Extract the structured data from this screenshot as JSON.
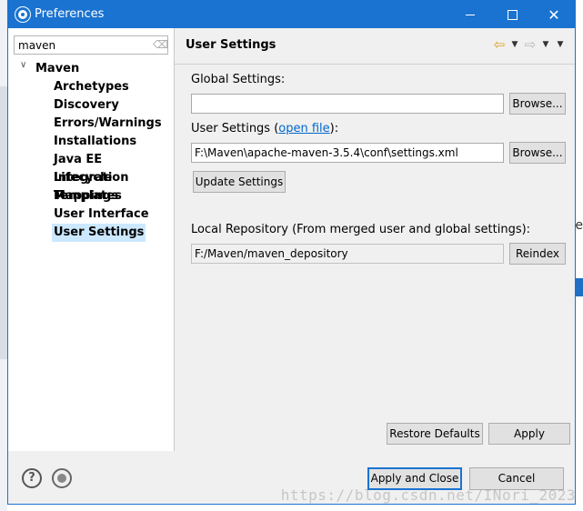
{
  "window": {
    "title": "Preferences"
  },
  "filter": {
    "value": "maven"
  },
  "tree": {
    "root": "Maven",
    "items": [
      "Archetypes",
      "Discovery",
      "Errors/Warnings",
      "Installations",
      "Java EE Integration",
      "Lifecycle Mappings",
      "Templates",
      "User Interface",
      "User Settings"
    ],
    "selected": "User Settings"
  },
  "page": {
    "title": "User Settings",
    "global_label": "Global Settings:",
    "global_value": "",
    "user_label_prefix": "User Settings (",
    "user_label_link": "open file",
    "user_label_suffix": "):",
    "user_value": "F:\\Maven\\apache-maven-3.5.4\\conf\\settings.xml",
    "browse_label": "Browse...",
    "update_label": "Update Settings",
    "local_repo_label": "Local Repository (From merged user and global settings):",
    "local_repo_value": "F:/Maven/maven_depository",
    "reindex_label": "Reindex",
    "restore_label": "Restore Defaults",
    "apply_label": "Apply"
  },
  "footer": {
    "apply_close_label": "Apply and Close",
    "cancel_label": "Cancel",
    "watermark": "https://blog.csdn.net/INori_2023"
  },
  "background": {
    "right_text": "e"
  },
  "colors": {
    "accent": "#1a73d0",
    "selection": "#cce8ff",
    "link": "#0066cc"
  }
}
